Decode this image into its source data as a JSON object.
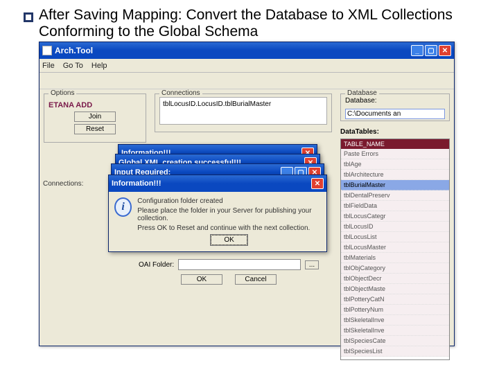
{
  "slide": {
    "title": "After Saving Mapping: Convert the Database to XML Collections Conforming to the Global Schema"
  },
  "app": {
    "title": "Arch.Tool",
    "menu": {
      "file": "File",
      "goto": "Go To",
      "help": "Help"
    },
    "options": {
      "group": "Options",
      "name": "ETANA ADD",
      "join": "Join",
      "reset": "Reset"
    },
    "connections": {
      "group": "Connections",
      "list": "tblLocusID.LocusID.tblBurialMaster"
    },
    "connections_lower": "Connections:",
    "database": {
      "group": "Database",
      "label": "Database:",
      "value": "C:\\Documents an"
    },
    "datatables": {
      "title": "DataTables:",
      "header": "TABLE_NAME",
      "rows": [
        "Paste Errors",
        "tblAge",
        "tblArchitecture",
        "tblBurialMaster",
        "tblDentalPreserv",
        "tblFieldData",
        "tblLocusCategr",
        "tblLocusID",
        "tblLocusList",
        "tblLocusMaster",
        "tblMaterials",
        "tblObjCategory",
        "tblObjectDecr",
        "tblObjectMaste",
        "tblPotteryCatN",
        "tblPotteryNum",
        "tblSkeletalInve",
        "tblSkeletalInve",
        "tblSpeciesCate",
        "tblSpeciesList"
      ],
      "selected_index": 3
    },
    "dialogs": {
      "d1": "Information!!!",
      "d2": "Global XML creation successful!!!",
      "d3": "Input Required:",
      "d4": {
        "title": "Information!!!",
        "line1": "Configuration folder created",
        "line2": "Please place the folder in your Server for publishing your collection.",
        "line3": "Press OK to Reset and continue with the next collection.",
        "ok": "OK"
      }
    },
    "oai": {
      "label": "OAI Folder:",
      "browse": "...",
      "ok": "OK",
      "cancel": "Cancel"
    }
  }
}
